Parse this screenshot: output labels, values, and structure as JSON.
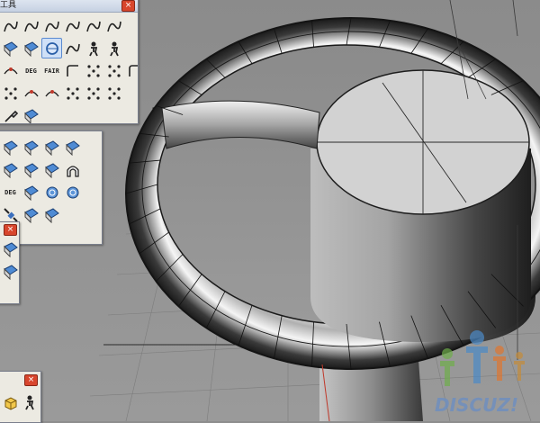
{
  "panel_top": {
    "title": "工具",
    "close": "×",
    "rows": [
      [
        {
          "name": "curve-hook-icon"
        },
        {
          "name": "curve-blend-icon"
        },
        {
          "name": "curve-step-icon"
        },
        {
          "name": "curve-s-icon"
        },
        {
          "name": "curve-match-icon"
        },
        {
          "name": "curve-arc-icon"
        }
      ],
      [
        {
          "name": "network-surface-icon"
        },
        {
          "name": "curve-on-surface-icon",
          "active": false
        },
        {
          "name": "curvature-circle-icon",
          "active": true
        },
        {
          "name": "curve-wave-icon"
        },
        {
          "name": "person-walk-icon"
        },
        {
          "name": "person-sit-icon"
        }
      ],
      [
        {
          "name": "rebuild-icon"
        },
        {
          "name": "deg-icon",
          "label": "DEG"
        },
        {
          "name": "fair-icon",
          "label": "FAIR"
        },
        {
          "name": "extend-icon"
        },
        {
          "name": "adjust-seam-icon"
        },
        {
          "name": "points-icon"
        },
        {
          "name": "fillet-icon"
        }
      ],
      [
        {
          "name": "control-points-icon"
        },
        {
          "name": "insert-knot-icon"
        },
        {
          "name": "remove-knot-icon"
        },
        {
          "name": "edit-point-icon"
        },
        {
          "name": "delete-point-icon"
        },
        {
          "name": "add-point-icon"
        }
      ],
      [
        {
          "name": "handle-icon"
        },
        {
          "name": "blend-shape-icon"
        }
      ]
    ]
  },
  "panel_mid": {
    "rows": [
      [
        {
          "name": "surface-a-icon"
        },
        {
          "name": "surface-b-icon"
        },
        {
          "name": "surface-c-icon"
        },
        {
          "name": "surface-d-icon"
        }
      ],
      [
        {
          "name": "surface-e-icon"
        },
        {
          "name": "surface-f-icon"
        },
        {
          "name": "surface-g-icon"
        },
        {
          "name": "surface-arch-icon"
        }
      ],
      [
        {
          "name": "surface-deg-icon",
          "label": "DEG"
        },
        {
          "name": "surface-h-icon"
        },
        {
          "name": "surface-frame-icon"
        },
        {
          "name": "surface-sphere-icon"
        }
      ],
      [
        {
          "name": "satellite-icon"
        },
        {
          "name": "surface-i-icon"
        },
        {
          "name": "surface-j-icon"
        }
      ]
    ]
  },
  "panel_small": {
    "close": "×",
    "rows": [
      [
        {
          "name": "surface-k-icon"
        }
      ],
      [
        {
          "name": "surface-l-icon"
        }
      ]
    ]
  },
  "panel_bottom": {
    "close": "×",
    "rows": [
      [
        {
          "name": "box-icon"
        },
        {
          "name": "person-push-icon"
        }
      ]
    ]
  },
  "watermark": {
    "text": "DISCUZ!"
  },
  "colors": {
    "viewport": "#8e8e8e",
    "panel": "#eceae2",
    "titlebar": "#c6d1e2",
    "close": "#d8462d"
  }
}
